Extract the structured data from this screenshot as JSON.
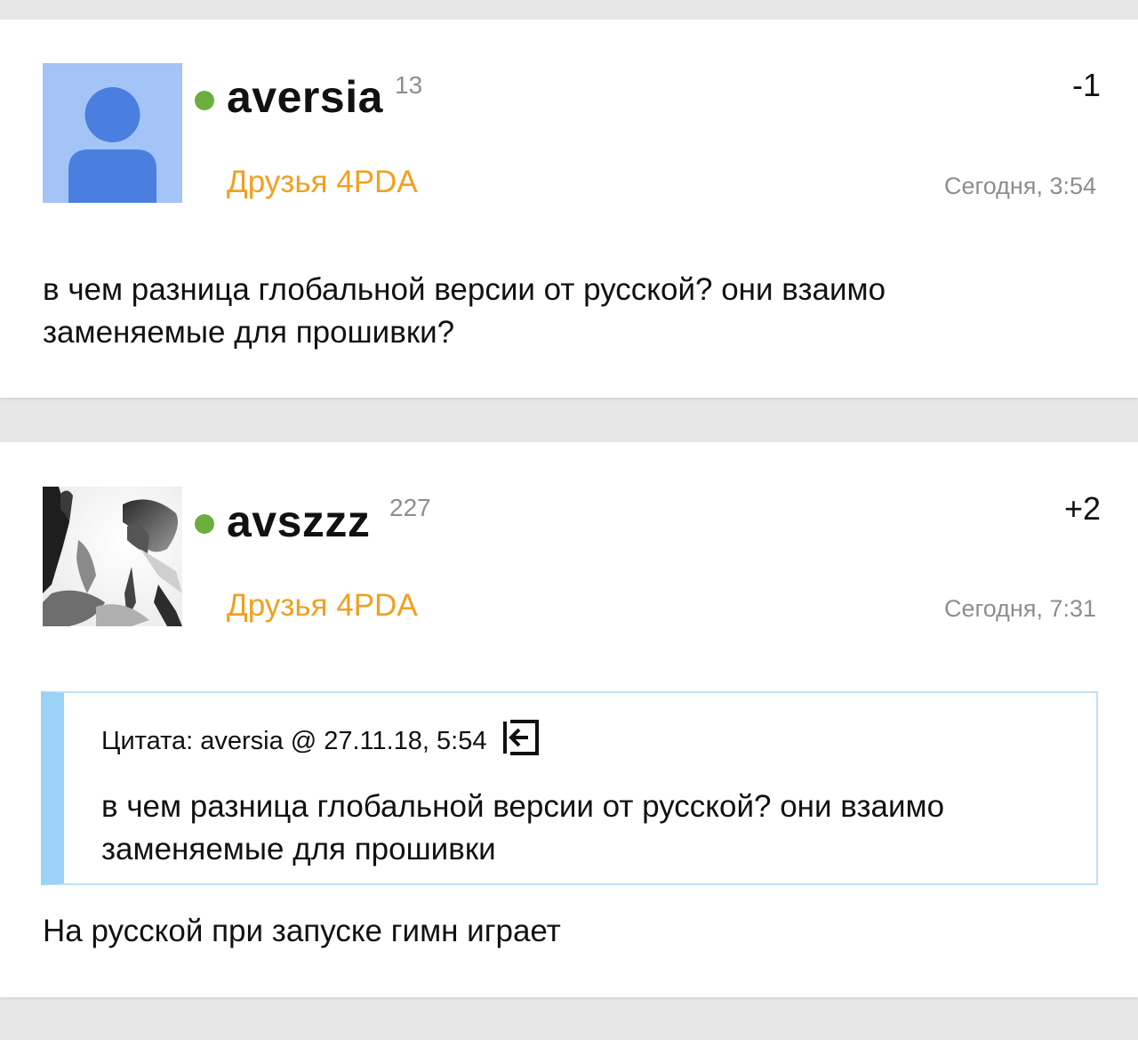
{
  "posts": [
    {
      "username": "aversia",
      "reputation": "13",
      "rating": "-1",
      "group": "Друзья 4PDA",
      "timestamp": "Сегодня, 3:54",
      "text": "в чем разница глобальной версии от русской? они взаимо заменяемые для прошивки?",
      "avatar": "default-user-avatar",
      "online": true
    },
    {
      "username": "avszzz",
      "reputation": "227",
      "rating": "+2",
      "group": "Друзья 4PDA",
      "timestamp": "Сегодня, 7:31",
      "avatar": "photo-avatar",
      "online": true,
      "quote": {
        "label": "Цитата:",
        "author": "aversia",
        "at": "@",
        "datetime": "27.11.18, 5:54",
        "text": "в чем разница глобальной версии от русской? они взаимо заменяемые для прошивки",
        "icon": "go-to-quote-icon"
      },
      "text": "На русской при запуске гимн играет"
    }
  ],
  "colors": {
    "online": "#6cae3e",
    "group": "#f0a020",
    "quote_bar": "#9bd2f5",
    "background": "#e6e6e6"
  }
}
